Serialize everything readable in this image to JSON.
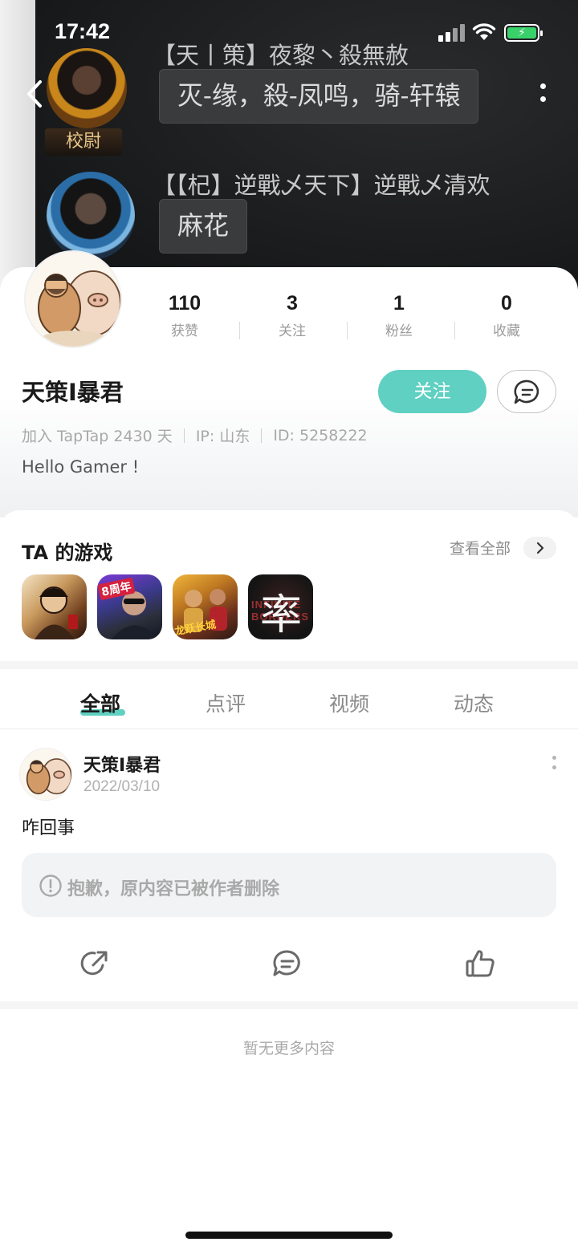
{
  "status_bar": {
    "time": "17:42"
  },
  "cover": {
    "sender1_name": "【天丨策】夜黎丶殺無赦",
    "sender1_rank": "校尉",
    "sender1_message": "灭-缘，殺-凤鸣，骑-轩辕",
    "sender2_name": "【【杞】逆戰乄天下】逆戰乄清欢",
    "sender2_message": "麻花"
  },
  "profile": {
    "username": "天策I暴君",
    "stats": [
      {
        "value": "110",
        "label": "获赞"
      },
      {
        "value": "3",
        "label": "关注"
      },
      {
        "value": "1",
        "label": "粉丝"
      },
      {
        "value": "0",
        "label": "收藏"
      }
    ],
    "follow_label": "关注",
    "meta": {
      "joined": "加入 TapTap 2430 天",
      "ip": "IP: 山东",
      "id": "ID: 5258222"
    },
    "bio": "Hello Gamer !"
  },
  "games": {
    "title": "TA 的游戏",
    "view_all": "查看全部",
    "items": [
      {
        "name": "game-icon-1"
      },
      {
        "name": "game-icon-2",
        "badge": "8周年"
      },
      {
        "name": "game-icon-3",
        "badge": "龙跃长城"
      },
      {
        "name": "game-icon-4",
        "glyph": "率",
        "subtitle": "INFINITE BORDERS"
      }
    ]
  },
  "tabs": [
    "全部",
    "点评",
    "视频",
    "动态"
  ],
  "post": {
    "author": "天策I暴君",
    "date": "2022/03/10",
    "text": "咋回事",
    "deleted_notice": "抱歉，原内容已被作者删除"
  },
  "footer": {
    "no_more": "暂无更多内容"
  },
  "colors": {
    "accent": "#5fd0c2",
    "text_primary": "#1a1a1a",
    "text_secondary": "#a9a9a9"
  }
}
